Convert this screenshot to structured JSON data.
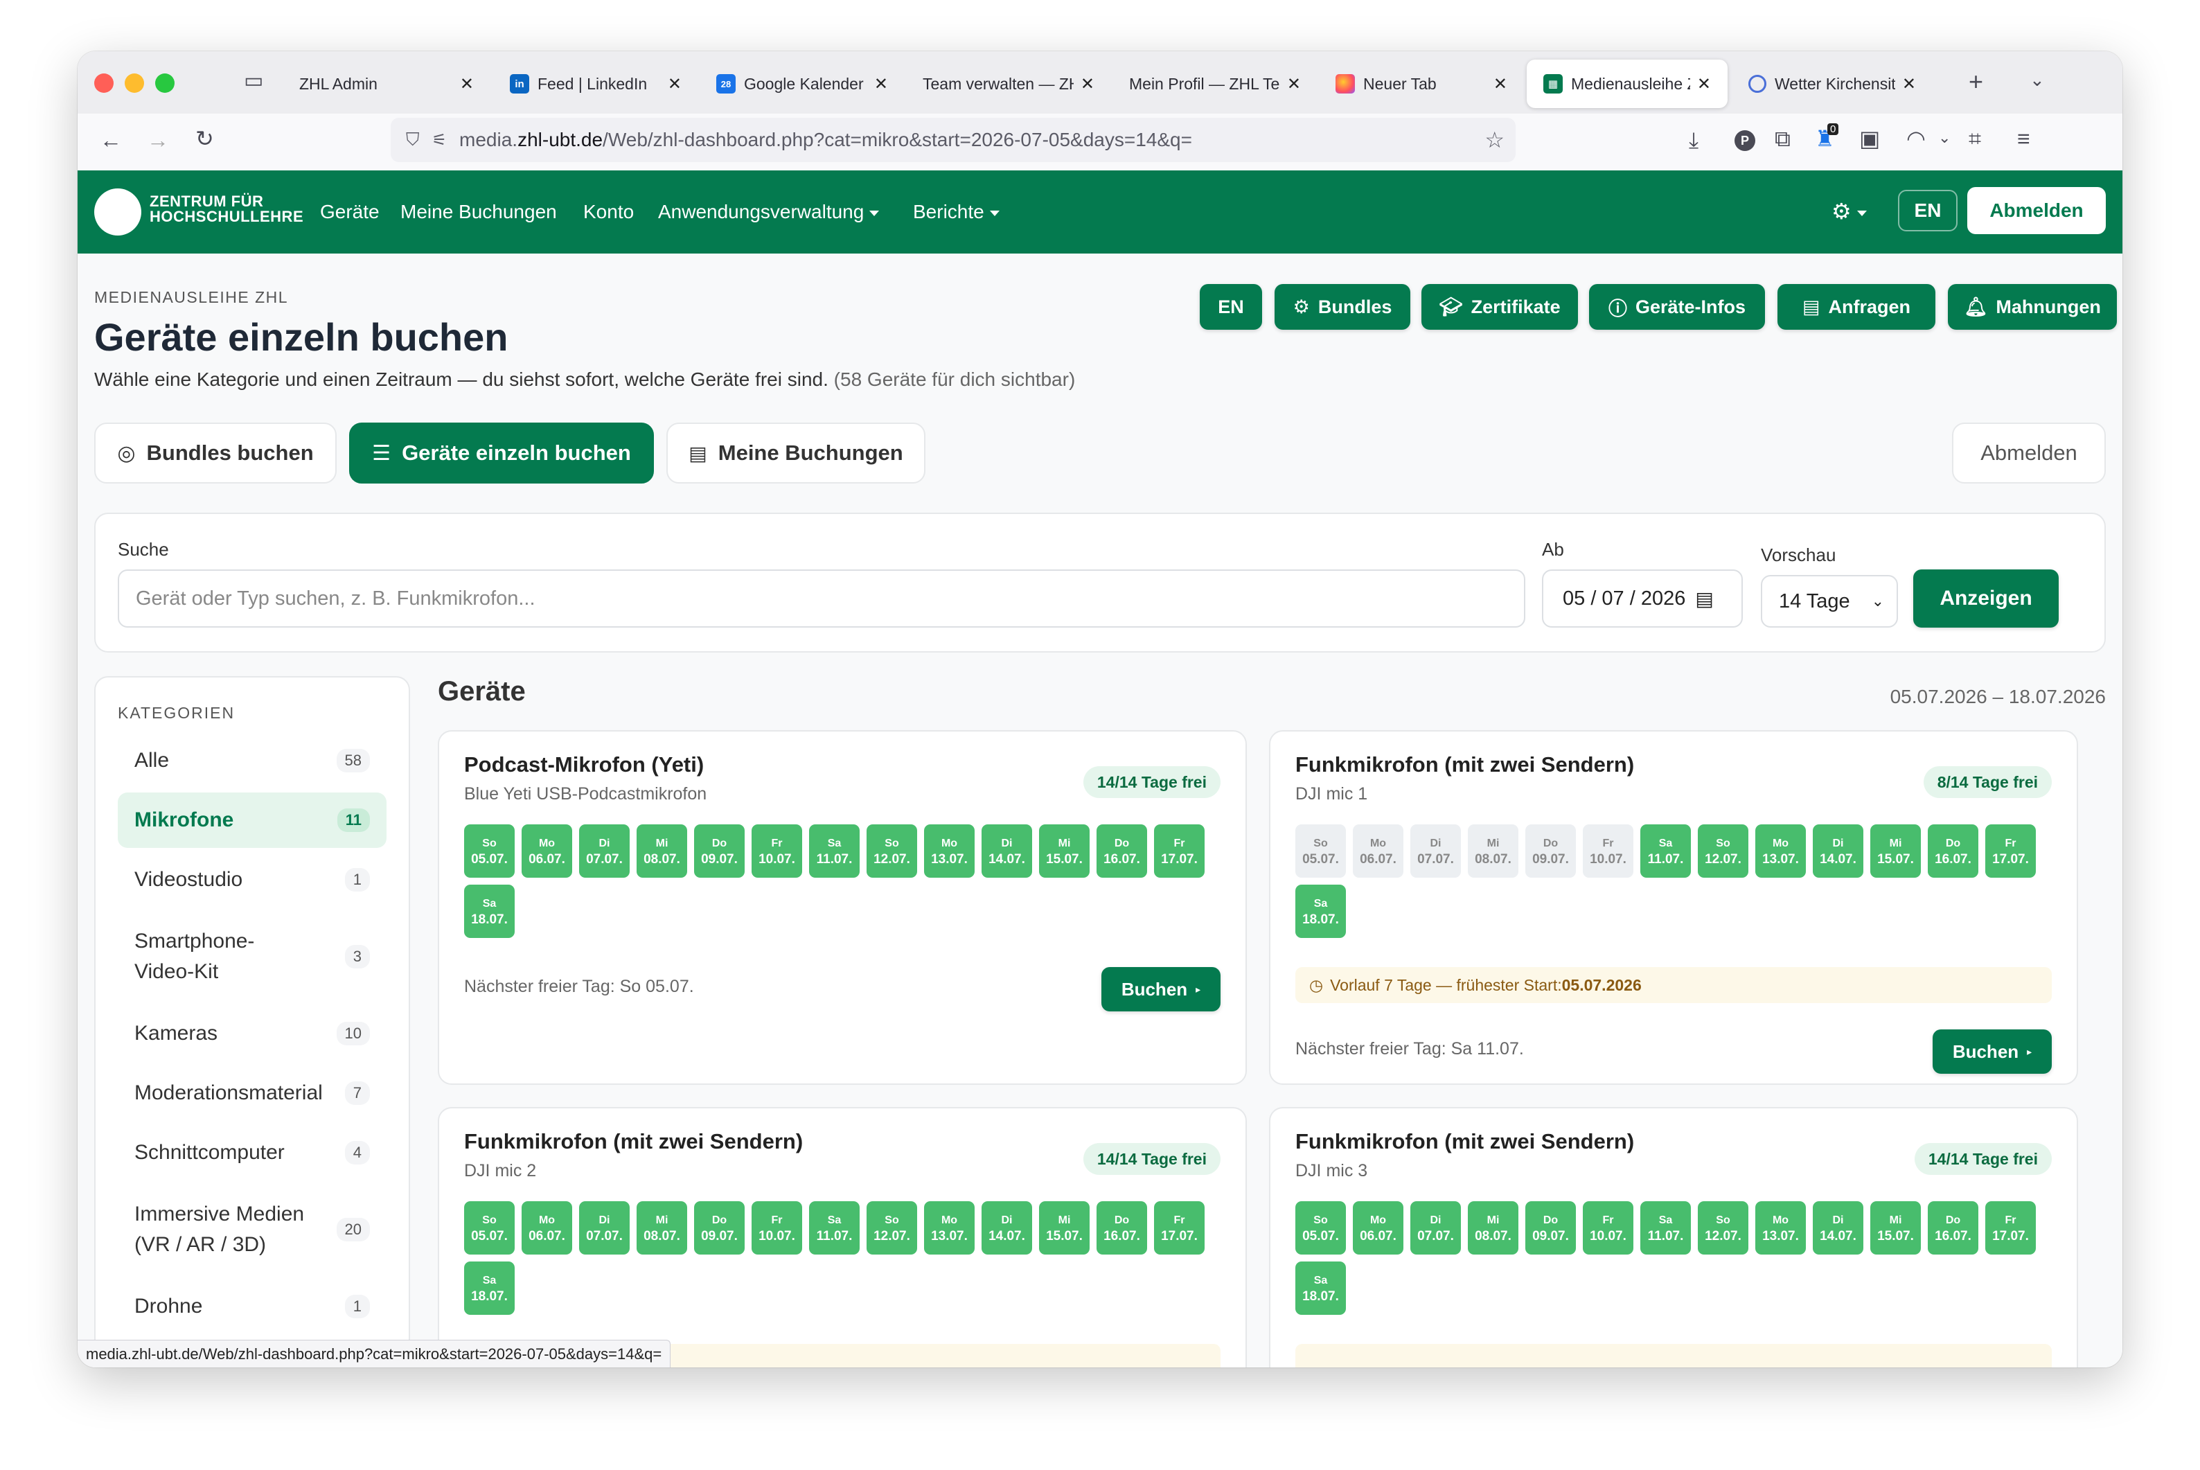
{
  "browser": {
    "tabs": [
      {
        "label": "ZHL Admin",
        "icon": "folder-icon"
      },
      {
        "label": "Feed | LinkedIn",
        "icon": "linkedin-icon"
      },
      {
        "label": "Google Kalender",
        "icon": "calendar-icon",
        "fav_text": "28"
      },
      {
        "label": "Team verwalten — ZHL",
        "icon": "none"
      },
      {
        "label": "Mein Profil — ZHL Team",
        "icon": "none"
      },
      {
        "label": "Neuer Tab",
        "icon": "firefox-icon"
      },
      {
        "label": "Medienausleihe ZHL",
        "icon": "media-icon",
        "active": true
      },
      {
        "label": "Wetter Kirchensittenbach",
        "icon": "globe-icon"
      }
    ],
    "url_prefix": "media.",
    "url_host": "zhl-ubt.de",
    "url_path": "/Web/zhl-dashboard.php?cat=mikro&start=2026-07-05&days=14&q=",
    "notif_count": "0",
    "status_url": "media.zhl-ubt.de/Web/zhl-dashboard.php?cat=mikro&start=2026-07-05&days=14&q="
  },
  "nav": {
    "logo_line1": "ZENTRUM FÜR",
    "logo_line2": "HOCHSCHULLEHRE",
    "items": [
      "Geräte",
      "Meine Buchungen",
      "Konto",
      "Anwendungsverwaltung",
      "Berichte"
    ],
    "lang": "EN",
    "logout": "Abmelden"
  },
  "header": {
    "kicker": "MEDIENAUSLEIHE ZHL",
    "title": "Geräte einzeln buchen",
    "desc": "Wähle eine Kategorie und einen Zeitraum — du siehst sofort, welche Geräte frei sind.",
    "desc_count": "(58 Geräte für dich sichtbar)",
    "actions": [
      "EN",
      "Bundles",
      "Zertifikate",
      "Geräte-Infos",
      "Anfragen",
      "Mahnungen"
    ]
  },
  "modes": {
    "bundles": "Bundles buchen",
    "single": "Geräte einzeln buchen",
    "mine": "Meine Buchungen",
    "logout": "Abmelden"
  },
  "search": {
    "label": "Suche",
    "placeholder": "Gerät oder Typ suchen, z. B. Funkmikrofon...",
    "from_label": "Ab",
    "from_value": "05 / 07 / 2026",
    "preview_label": "Vorschau",
    "preview_value": "14 Tage",
    "submit": "Anzeigen"
  },
  "categories": {
    "title": "KATEGORIEN",
    "items": [
      {
        "name": "Alle",
        "count": "58"
      },
      {
        "name": "Mikrofone",
        "count": "11",
        "selected": true
      },
      {
        "name": "Videostudio",
        "count": "1"
      },
      {
        "name": "Smartphone-\nVideo-Kit",
        "count": "3"
      },
      {
        "name": "Kameras",
        "count": "10"
      },
      {
        "name": "Moderationsmaterial",
        "count": "7"
      },
      {
        "name": "Schnittcomputer",
        "count": "4"
      },
      {
        "name": "Immersive Medien\n(VR / AR / 3D)",
        "count": "20"
      },
      {
        "name": "Drohne",
        "count": "1"
      }
    ]
  },
  "devices": {
    "title": "Geräte",
    "range": "05.07.2026 – 18.07.2026",
    "days": [
      [
        "So",
        "05.07."
      ],
      [
        "Mo",
        "06.07."
      ],
      [
        "Di",
        "07.07."
      ],
      [
        "Mi",
        "08.07."
      ],
      [
        "Do",
        "09.07."
      ],
      [
        "Fr",
        "10.07."
      ],
      [
        "Sa",
        "11.07."
      ],
      [
        "So",
        "12.07."
      ],
      [
        "Mo",
        "13.07."
      ],
      [
        "Di",
        "14.07."
      ],
      [
        "Mi",
        "15.07."
      ],
      [
        "Do",
        "16.07."
      ],
      [
        "Fr",
        "17.07."
      ],
      [
        "Sa",
        "18.07."
      ]
    ],
    "book_label": "Buchen",
    "cards": [
      {
        "title": "Podcast-Mikrofon (Yeti)",
        "sub": "Blue Yeti USB-Podcastmikrofon",
        "badge": "14/14 Tage frei",
        "free": [
          true,
          true,
          true,
          true,
          true,
          true,
          true,
          true,
          true,
          true,
          true,
          true,
          true,
          true
        ],
        "next": "Nächster freier Tag: So 05.07."
      },
      {
        "title": "Funkmikrofon (mit zwei Sendern)",
        "sub": "DJI mic 1",
        "badge": "8/14 Tage frei",
        "free": [
          false,
          false,
          false,
          false,
          false,
          false,
          true,
          true,
          true,
          true,
          true,
          true,
          true,
          true
        ],
        "warn_text": "Vorlauf 7 Tage — frühester Start: ",
        "warn_date": "05.07.2026",
        "next": "Nächster freier Tag: Sa 11.07."
      },
      {
        "title": "Funkmikrofon (mit zwei Sendern)",
        "sub": "DJI mic 2",
        "badge": "14/14 Tage frei",
        "free": [
          true,
          true,
          true,
          true,
          true,
          true,
          true,
          true,
          true,
          true,
          true,
          true,
          true,
          true
        ]
      },
      {
        "title": "Funkmikrofon (mit zwei Sendern)",
        "sub": "DJI mic 3",
        "badge": "14/14 Tage frei",
        "free": [
          true,
          true,
          true,
          true,
          true,
          true,
          true,
          true,
          true,
          true,
          true,
          true,
          true,
          true
        ]
      }
    ]
  }
}
